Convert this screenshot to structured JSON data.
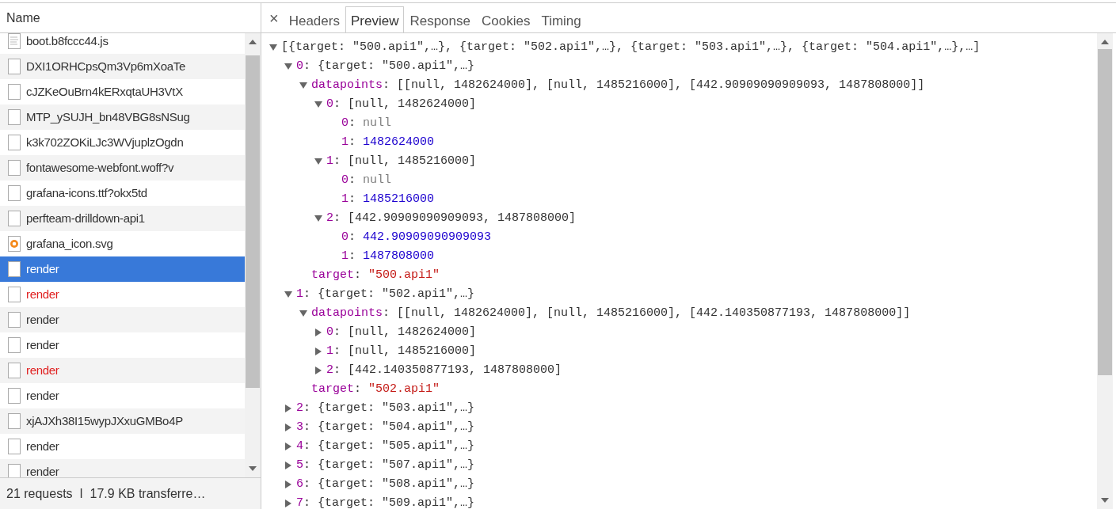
{
  "requests": {
    "column": "Name",
    "rows": [
      {
        "name": "boot.b8fccc44.js",
        "kind": "script",
        "failed": false,
        "selected": false
      },
      {
        "name": "DXI1ORHCpsQm3Vp6mXoaTe",
        "kind": "blank",
        "failed": false,
        "selected": false
      },
      {
        "name": "cJZKeOuBrn4kERxqtaUH3VtX",
        "kind": "blank",
        "failed": false,
        "selected": false
      },
      {
        "name": "MTP_ySUJH_bn48VBG8sNSug",
        "kind": "blank",
        "failed": false,
        "selected": false
      },
      {
        "name": "k3k702ZOKiLJc3WVjuplzOgdn",
        "kind": "blank",
        "failed": false,
        "selected": false
      },
      {
        "name": "fontawesome-webfont.woff?v",
        "kind": "blank",
        "failed": false,
        "selected": false
      },
      {
        "name": "grafana-icons.ttf?okx5td",
        "kind": "blank",
        "failed": false,
        "selected": false
      },
      {
        "name": "perfteam-drilldown-api1",
        "kind": "blank",
        "failed": false,
        "selected": false
      },
      {
        "name": "grafana_icon.svg",
        "kind": "image",
        "failed": false,
        "selected": false
      },
      {
        "name": "render",
        "kind": "blank",
        "failed": false,
        "selected": true
      },
      {
        "name": "render",
        "kind": "blank",
        "failed": true,
        "selected": false
      },
      {
        "name": "render",
        "kind": "blank",
        "failed": false,
        "selected": false
      },
      {
        "name": "render",
        "kind": "blank",
        "failed": false,
        "selected": false
      },
      {
        "name": "render",
        "kind": "blank",
        "failed": true,
        "selected": false
      },
      {
        "name": "render",
        "kind": "blank",
        "failed": false,
        "selected": false
      },
      {
        "name": "xjAJXh38I15wypJXxuGMBo4P",
        "kind": "blank",
        "failed": false,
        "selected": false
      },
      {
        "name": "render",
        "kind": "blank",
        "failed": false,
        "selected": false
      },
      {
        "name": "render",
        "kind": "blank",
        "failed": false,
        "selected": false
      }
    ],
    "summary": "21 requests  ǀ  17.9 KB transferre…"
  },
  "close": "×",
  "tabs": [
    {
      "label": "Headers",
      "selected": false
    },
    {
      "label": "Preview",
      "selected": true
    },
    {
      "label": "Response",
      "selected": false
    },
    {
      "label": "Cookies",
      "selected": false
    },
    {
      "label": "Timing",
      "selected": false
    }
  ],
  "preview": {
    "separator": ": ",
    "summary": "[{target: \"500.api1\",…}, {target: \"502.api1\",…}, {target: \"503.api1\",…}, {target: \"504.api1\",…},…]",
    "expanded": true,
    "children": [
      {
        "key": "0",
        "summary": "{target: \"500.api1\",…}",
        "expanded": true,
        "children": [
          {
            "key": "datapoints",
            "summary": "[[null, 1482624000], [null, 1485216000], [442.90909090909093, 1487808000]]",
            "expanded": true,
            "children": [
              {
                "key": "0",
                "summary": "[null, 1482624000]",
                "expanded": true,
                "children": [
                  {
                    "key": "0",
                    "value": "null",
                    "kind": "null"
                  },
                  {
                    "key": "1",
                    "value": "1482624000",
                    "kind": "number"
                  }
                ]
              },
              {
                "key": "1",
                "summary": "[null, 1485216000]",
                "expanded": true,
                "children": [
                  {
                    "key": "0",
                    "value": "null",
                    "kind": "null"
                  },
                  {
                    "key": "1",
                    "value": "1485216000",
                    "kind": "number"
                  }
                ]
              },
              {
                "key": "2",
                "summary": "[442.90909090909093, 1487808000]",
                "expanded": true,
                "children": [
                  {
                    "key": "0",
                    "value": "442.90909090909093",
                    "kind": "number"
                  },
                  {
                    "key": "1",
                    "value": "1487808000",
                    "kind": "number"
                  }
                ]
              }
            ]
          },
          {
            "key": "target",
            "value": "\"500.api1\"",
            "kind": "string"
          }
        ]
      },
      {
        "key": "1",
        "summary": "{target: \"502.api1\",…}",
        "expanded": true,
        "children": [
          {
            "key": "datapoints",
            "summary": "[[null, 1482624000], [null, 1485216000], [442.140350877193, 1487808000]]",
            "expanded": true,
            "children": [
              {
                "key": "0",
                "summary": "[null, 1482624000]",
                "expanded": false
              },
              {
                "key": "1",
                "summary": "[null, 1485216000]",
                "expanded": false
              },
              {
                "key": "2",
                "summary": "[442.140350877193, 1487808000]",
                "expanded": false
              }
            ]
          },
          {
            "key": "target",
            "value": "\"502.api1\"",
            "kind": "string"
          }
        ]
      },
      {
        "key": "2",
        "summary": "{target: \"503.api1\",…}",
        "expanded": false
      },
      {
        "key": "3",
        "summary": "{target: \"504.api1\",…}",
        "expanded": false
      },
      {
        "key": "4",
        "summary": "{target: \"505.api1\",…}",
        "expanded": false
      },
      {
        "key": "5",
        "summary": "{target: \"507.api1\",…}",
        "expanded": false
      },
      {
        "key": "6",
        "summary": "{target: \"508.api1\",…}",
        "expanded": false
      },
      {
        "key": "7",
        "summary": "{target: \"509.api1\",…}",
        "expanded": false
      }
    ]
  }
}
